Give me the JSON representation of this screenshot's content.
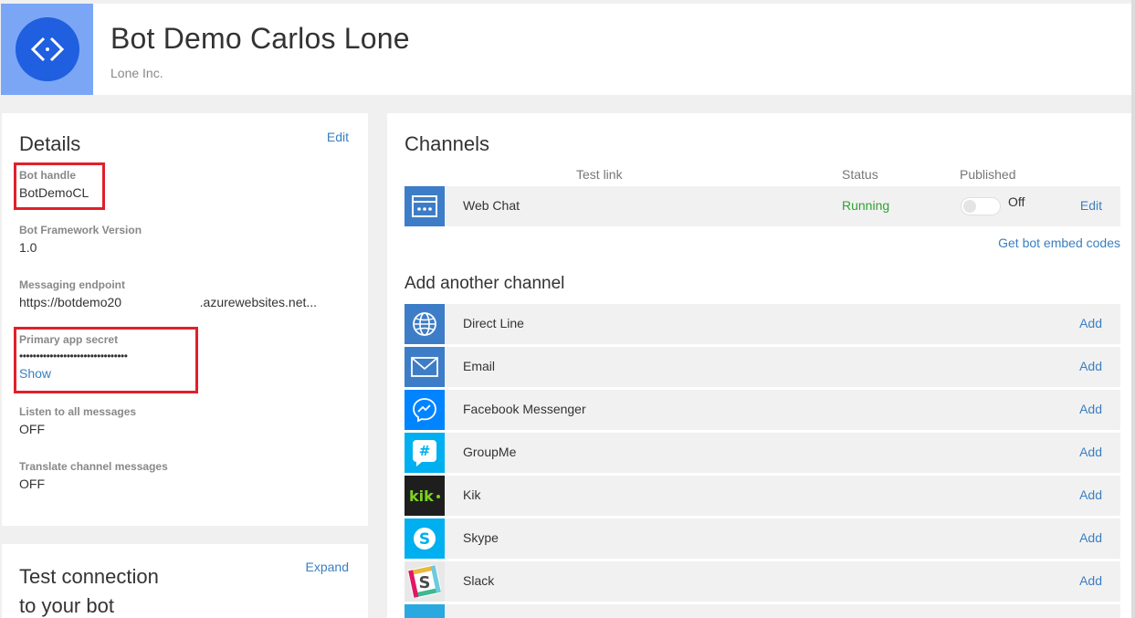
{
  "header": {
    "bot_name": "Bot Demo Carlos Lone",
    "org": "Lone Inc.",
    "logo_icon": "code-brackets-icon"
  },
  "details": {
    "title": "Details",
    "edit_label": "Edit",
    "fields": [
      {
        "label": "Bot handle",
        "value": "BotDemoCL"
      },
      {
        "label": "Bot Framework Version",
        "value": "1.0"
      },
      {
        "label": "Messaging endpoint",
        "value": "https://botdemo20                      .azurewebsites.net..."
      },
      {
        "label": "Primary app secret",
        "value": "••••••••••••••••••••••••••••••••",
        "action": "Show"
      },
      {
        "label": "Listen to all messages",
        "value": "OFF"
      },
      {
        "label": "Translate channel messages",
        "value": "OFF"
      }
    ]
  },
  "test": {
    "title_line1": "Test connection",
    "title_line2": "to your bot",
    "expand_label": "Expand"
  },
  "channels": {
    "title": "Channels",
    "columns": {
      "test_link": "Test link",
      "status": "Status",
      "published": "Published"
    },
    "active": [
      {
        "name": "Web Chat",
        "status": "Running",
        "published": "Off",
        "edit_label": "Edit",
        "icon": "web-chat-icon",
        "color": "#3d7dc8"
      }
    ],
    "embed_link": "Get bot embed codes",
    "add_title": "Add another channel",
    "add_label": "Add",
    "available": [
      {
        "name": "Direct Line",
        "icon": "globe-icon",
        "color": "#3d7dc8"
      },
      {
        "name": "Email",
        "icon": "envelope-icon",
        "color": "#3d7dc8"
      },
      {
        "name": "Facebook Messenger",
        "icon": "messenger-icon",
        "color": "#0084ff"
      },
      {
        "name": "GroupMe",
        "icon": "groupme-icon",
        "color": "#00aff0"
      },
      {
        "name": "Kik",
        "icon": "kik-icon",
        "color": "#1e1e1e"
      },
      {
        "name": "Skype",
        "icon": "skype-icon",
        "color": "#00aff0"
      },
      {
        "name": "Slack",
        "icon": "slack-icon",
        "color": "#4a4a4a"
      }
    ],
    "status_color": "#2fa32f"
  }
}
